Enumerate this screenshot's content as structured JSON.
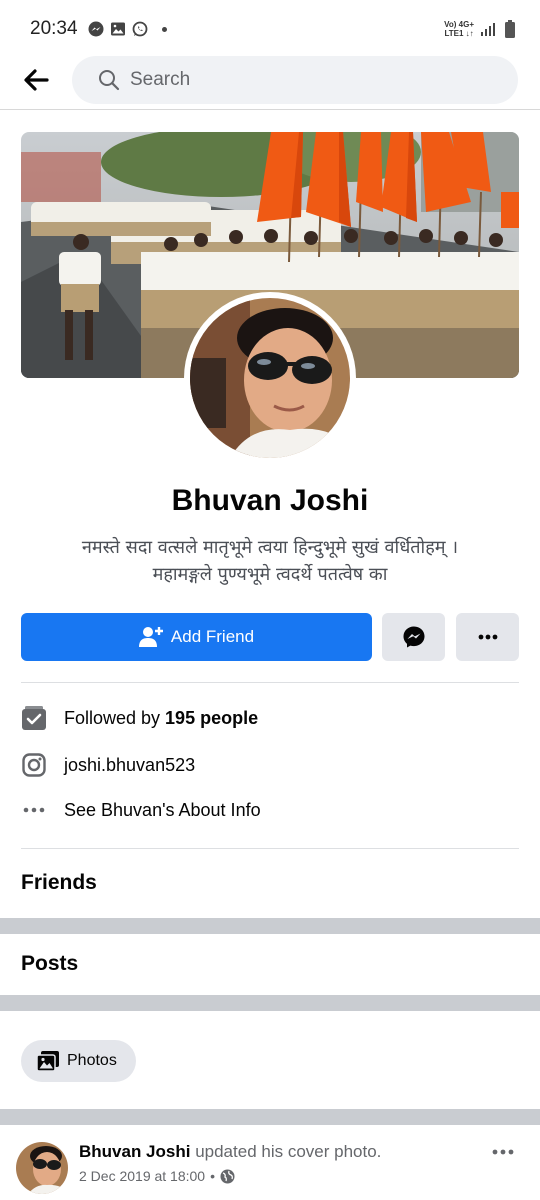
{
  "status_bar": {
    "time": "20:34",
    "network_line1": "Vo) 4G+",
    "network_line2": "LTE1 ↓↑"
  },
  "search": {
    "placeholder": "Search"
  },
  "profile": {
    "name": "Bhuvan Joshi",
    "bio_line1": "नमस्ते सदा वत्सले मातृभूमे त्वया हिन्दुभूमे सुखं वर्धितोहम् ।",
    "bio_line2": "महामङ्गले पुण्यभूमे त्वदर्थे पतत्वेष का"
  },
  "actions": {
    "add_friend_label": "Add Friend"
  },
  "info": {
    "followed_prefix": "Followed by",
    "followed_count": "195 people",
    "instagram": "joshi.bhuvan523",
    "about": "See Bhuvan's About Info"
  },
  "sections": {
    "friends": "Friends",
    "posts": "Posts",
    "photos_chip": "Photos"
  },
  "post": {
    "author": "Bhuvan Joshi",
    "action": " updated his cover photo.",
    "date": "2 Dec 2019 at 18:00",
    "separator": "•"
  },
  "colors": {
    "accent": "#1877f2",
    "button_gray": "#e4e6eb",
    "band_gray": "#c9ccd1",
    "flag_orange": "#f05a14"
  },
  "icons": {
    "back": "arrow-left-icon",
    "search": "search-icon",
    "add_friend": "person-add-icon",
    "messenger": "messenger-icon",
    "more": "more-dots-icon",
    "followers": "followers-icon",
    "instagram": "instagram-icon",
    "about": "more-dots-icon",
    "photos": "photos-icon",
    "privacy": "globe-icon"
  }
}
